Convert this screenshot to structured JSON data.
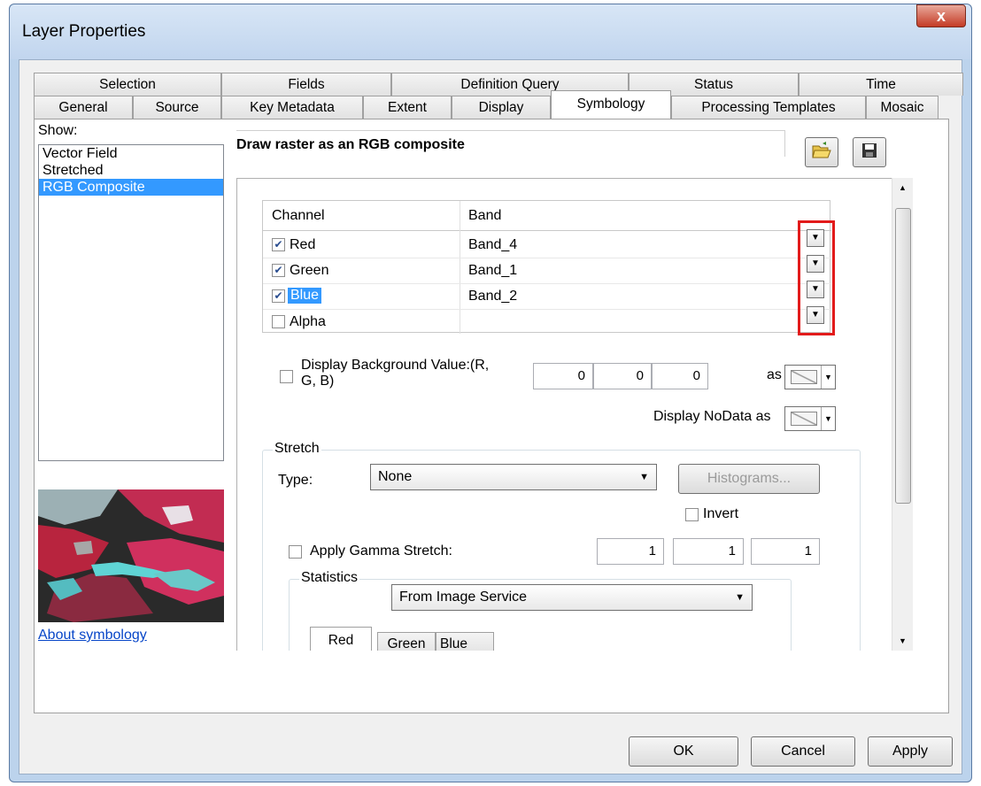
{
  "window": {
    "title": "Layer Properties",
    "close_label": "x"
  },
  "tabs_row1": [
    "Selection",
    "Fields",
    "Definition Query",
    "Status",
    "Time"
  ],
  "tabs_row2": [
    "General",
    "Source",
    "Key Metadata",
    "Extent",
    "Display",
    "Symbology",
    "Processing Templates",
    "Mosaic"
  ],
  "active_tab": "Symbology",
  "show": {
    "label": "Show:",
    "items": [
      "Vector Field",
      "Stretched",
      "RGB Composite"
    ],
    "selected": "RGB Composite",
    "link": "About symbology"
  },
  "main": {
    "heading": "Draw raster as an RGB composite",
    "open_icon": "folder-open-icon",
    "save_icon": "save-disk-icon"
  },
  "grid": {
    "col_channel": "Channel",
    "col_band": "Band",
    "rows": [
      {
        "channel": "Red",
        "band": "Band_4",
        "checked": true
      },
      {
        "channel": "Green",
        "band": "Band_1",
        "checked": true
      },
      {
        "channel": "Blue",
        "band": "Band_2",
        "checked": true
      },
      {
        "channel": "Alpha",
        "band": "",
        "checked": false
      }
    ]
  },
  "background": {
    "label_line1": "Display Background Value:(R,",
    "label_line2": "G, B)",
    "values": [
      "0",
      "0",
      "0"
    ],
    "as_label": "as",
    "nodata_label": "Display NoData as"
  },
  "stretch": {
    "group_label": "Stretch",
    "type_label": "Type:",
    "type_value": "None",
    "histograms_label": "Histograms...",
    "invert_label": "Invert",
    "gamma_label": "Apply Gamma Stretch:",
    "gamma_values": [
      "1",
      "1",
      "1"
    ],
    "statistics_label": "Statistics",
    "statistics_value": "From Image Service",
    "stat_tabs": [
      "Red",
      "Green",
      "Blue"
    ]
  },
  "buttons": {
    "ok": "OK",
    "cancel": "Cancel",
    "apply": "Apply"
  }
}
